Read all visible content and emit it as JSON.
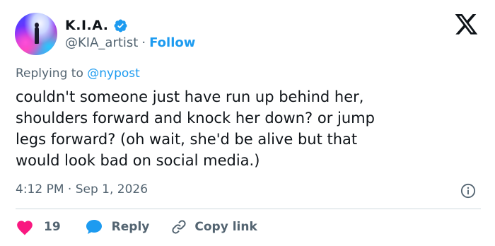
{
  "author": {
    "name": "K.I.A.",
    "handle": "@KIA_artist",
    "separator": "·",
    "follow_label": "Follow",
    "verified": true
  },
  "brand_logo": "x-logo-icon",
  "reply": {
    "prefix": "Replying to",
    "mention": "@nypost"
  },
  "tweet": {
    "text": "couldn't someone just have run up behind her,\nshoulders forward and knock her down? or jump\nlegs forward? (oh wait, she'd be alive but that\nwould look bad on social media.)"
  },
  "meta": {
    "time": "4:12 PM",
    "separator": "·",
    "date": "Sep 1, 2026",
    "info_icon": "info-icon"
  },
  "actions": {
    "like_count": "19",
    "reply_label": "Reply",
    "copy_label": "Copy link"
  },
  "colors": {
    "accent": "#1d9bf0",
    "like": "#f91880",
    "muted": "#536471",
    "text": "#0f1419",
    "divider": "#cfd9de"
  }
}
